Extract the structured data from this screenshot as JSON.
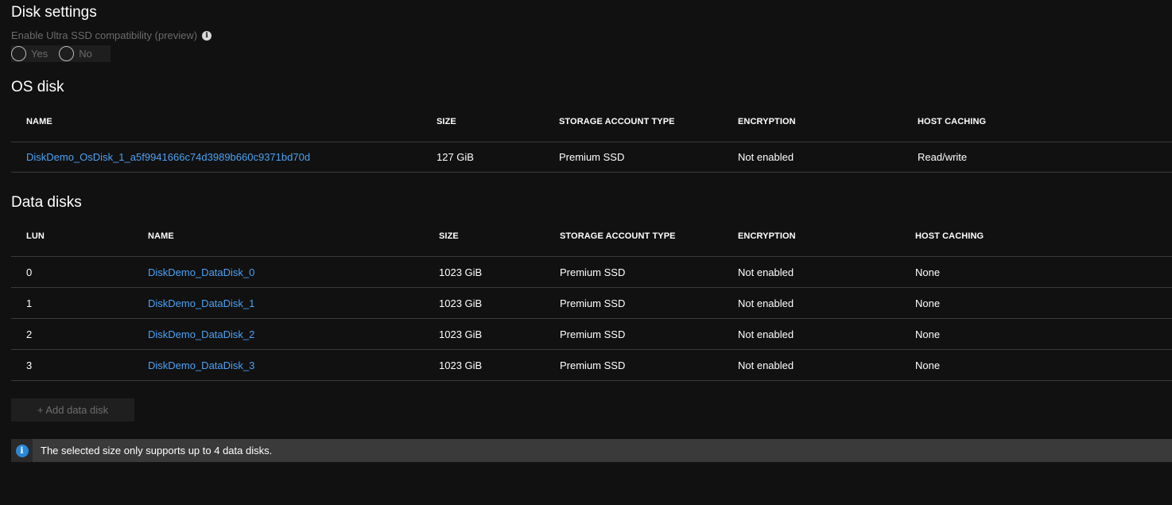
{
  "disk_settings": {
    "title": "Disk settings",
    "ultra_ssd_label": "Enable Ultra SSD compatibility (preview)",
    "ultra_ssd_options": [
      "Yes",
      "No"
    ],
    "info_icon": "info-icon"
  },
  "os_disk": {
    "title": "OS disk",
    "headers": [
      "NAME",
      "SIZE",
      "STORAGE ACCOUNT TYPE",
      "ENCRYPTION",
      "HOST CACHING"
    ],
    "row": {
      "name": "DiskDemo_OsDisk_1_a5f9941666c74d3989b660c9371bd70d",
      "size": "127 GiB",
      "storage_type": "Premium SSD",
      "encryption": "Not enabled",
      "host_caching": "Read/write"
    }
  },
  "data_disks": {
    "title": "Data disks",
    "headers": [
      "LUN",
      "NAME",
      "SIZE",
      "STORAGE ACCOUNT TYPE",
      "ENCRYPTION",
      "HOST CACHING"
    ],
    "rows": [
      {
        "lun": "0",
        "name": "DiskDemo_DataDisk_0",
        "size": "1023 GiB",
        "storage_type": "Premium SSD",
        "encryption": "Not enabled",
        "host_caching": "None"
      },
      {
        "lun": "1",
        "name": "DiskDemo_DataDisk_1",
        "size": "1023 GiB",
        "storage_type": "Premium SSD",
        "encryption": "Not enabled",
        "host_caching": "None"
      },
      {
        "lun": "2",
        "name": "DiskDemo_DataDisk_2",
        "size": "1023 GiB",
        "storage_type": "Premium SSD",
        "encryption": "Not enabled",
        "host_caching": "None"
      },
      {
        "lun": "3",
        "name": "DiskDemo_DataDisk_3",
        "size": "1023 GiB",
        "storage_type": "Premium SSD",
        "encryption": "Not enabled",
        "host_caching": "None"
      }
    ],
    "add_button_label": "+ Add data disk"
  },
  "info_bar": {
    "message": "The selected size only supports up to 4 data disks."
  },
  "colors": {
    "background": "#111111",
    "link": "#4ea1f3",
    "info_accent": "#2b88d8",
    "disabled_text": "#6b6b6b"
  }
}
